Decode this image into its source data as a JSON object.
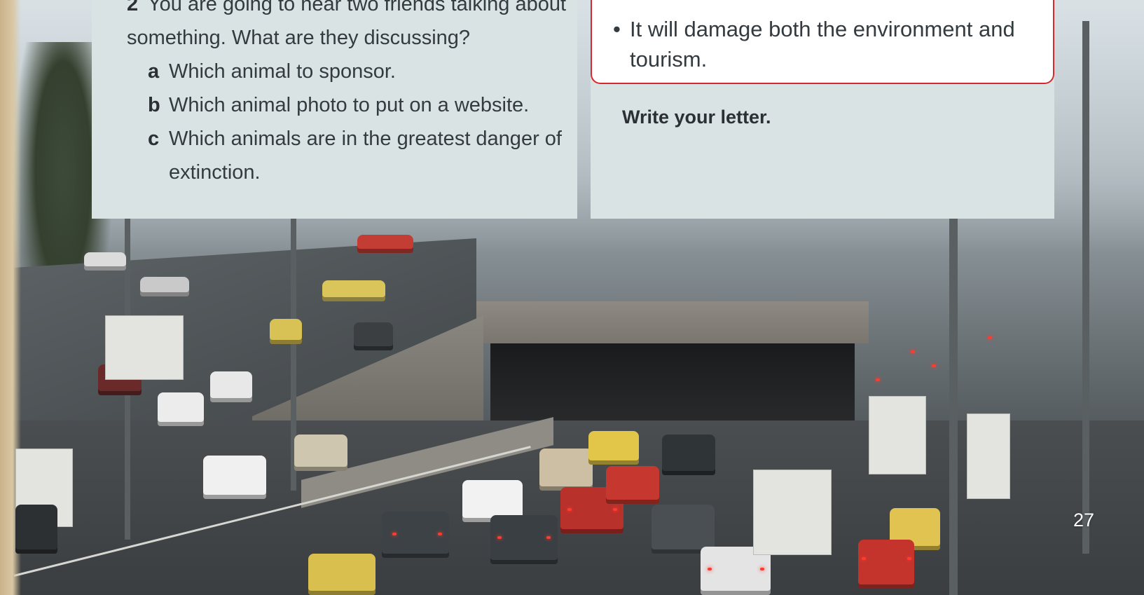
{
  "question": {
    "number": "2",
    "text": "You are going to hear two friends talking about something. What are they discussing?",
    "options": [
      {
        "letter": "a",
        "text": "Which animal to sponsor."
      },
      {
        "letter": "b",
        "text": "Which animal photo to put on a website."
      },
      {
        "letter": "c",
        "text": "Which animals are in the greatest danger of extinction."
      }
    ]
  },
  "bullet_box": {
    "bullet": "•",
    "text": "It will damage both the environment and tourism."
  },
  "instruction": "Write your letter.",
  "page_number": "27",
  "colors": {
    "panel": "#d9e3e4",
    "box_border": "#d7282f",
    "text": "#333b40"
  }
}
